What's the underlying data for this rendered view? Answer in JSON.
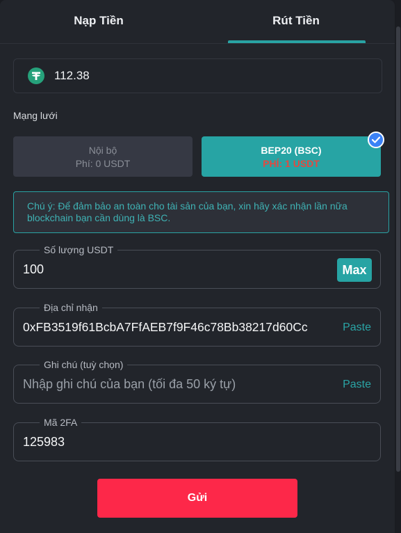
{
  "tabs": [
    {
      "label": "Nạp Tiền",
      "active": false
    },
    {
      "label": "Rút Tiền",
      "active": true
    }
  ],
  "balance": {
    "currency_icon": "tether-icon",
    "amount": "112.38"
  },
  "network": {
    "label": "Mạng lưới",
    "options": [
      {
        "name": "Nội bộ",
        "fee": "Phí: 0 USDT",
        "selected": false
      },
      {
        "name": "BEP20 (BSC)",
        "fee": "PHÍ: 1 USDT",
        "selected": true
      }
    ]
  },
  "notice": "Chú ý: Để đảm bảo an toàn cho tài sản của bạn, xin hãy xác nhận lần nữa blockchain bạn cần dùng là BSC.",
  "amount_field": {
    "legend": "Số lượng USDT",
    "value": "100",
    "max_label": "Max"
  },
  "address_field": {
    "legend": "Địa chỉ nhận",
    "value": "0xFB3519f61BcbA7FfAEB7f9F46c78Bb38217d60Cc",
    "paste_label": "Paste"
  },
  "note_field": {
    "legend": "Ghi chú (tuỳ chọn)",
    "placeholder": "Nhập ghi chú của bạn (tối đa 50 ký tự)",
    "paste_label": "Paste"
  },
  "twofa_field": {
    "legend": "Mã 2FA",
    "value": "125983"
  },
  "submit_label": "Gửi",
  "colors": {
    "accent": "#27a4a4",
    "danger": "#fd2849",
    "fee": "#e5483f",
    "check": "#3b82f6"
  }
}
